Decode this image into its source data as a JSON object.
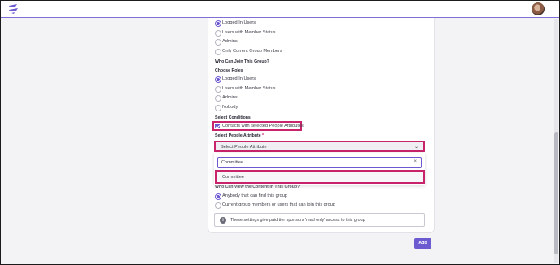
{
  "colors": {
    "accent": "#6b5ad0",
    "highlight": "#c8246b"
  },
  "topbar": {
    "logo_icon": "app-logo-icon",
    "avatar_icon": "user-avatar"
  },
  "view_options": [
    "Logged In Users",
    "Users with Member Status",
    "Admins",
    "Only Current Group Members"
  ],
  "join": {
    "heading": "Who Can Join This Group?",
    "sub": "Choose Roles",
    "options": [
      "Logged In Users",
      "Users with Member Status",
      "Admins",
      "Nobody"
    ]
  },
  "conditions": {
    "heading": "Select Conditions",
    "checkbox_label": "Contacts with selected People Attributes"
  },
  "attribute": {
    "label": "Select People Attribute",
    "required_mark": "*",
    "select_value": "Select People Attribute",
    "search_value": "Committee",
    "clear_icon": "×",
    "option": "Committee"
  },
  "content": {
    "heading_partial": "Who Can View the Content in This Group?",
    "options": [
      "Anybody that can find this group",
      "Current group members or users that can join this group"
    ]
  },
  "info": {
    "icon": "i",
    "text": "These settings give paid tier sponsors 'read only' access to this group"
  },
  "add_button": "Add"
}
